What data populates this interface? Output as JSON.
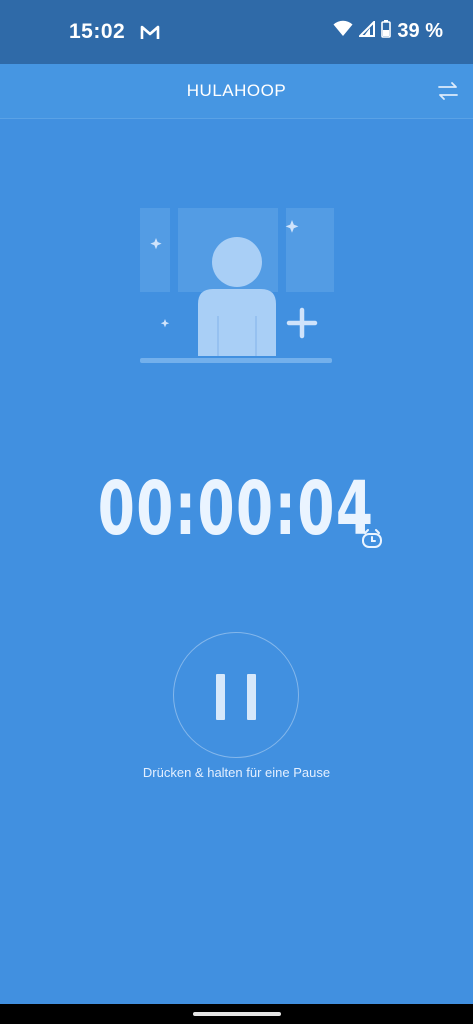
{
  "status_bar": {
    "time": "15:02",
    "battery": "39 %",
    "icons": [
      "gmail-icon",
      "wifi-icon",
      "signal-icon",
      "battery-icon"
    ]
  },
  "app_bar": {
    "title": "HULAHOOP",
    "swap_icon": "swap-arrows-icon"
  },
  "timer": {
    "value": "00:00:04",
    "icon": "timer-clock-icon"
  },
  "pause": {
    "icon": "pause-icon",
    "hint": "Drücken & halten für eine Pause"
  },
  "colors": {
    "background": "#4190e0",
    "status_bar": "#2f6aa8",
    "accent_light": "#d6e8fb"
  }
}
